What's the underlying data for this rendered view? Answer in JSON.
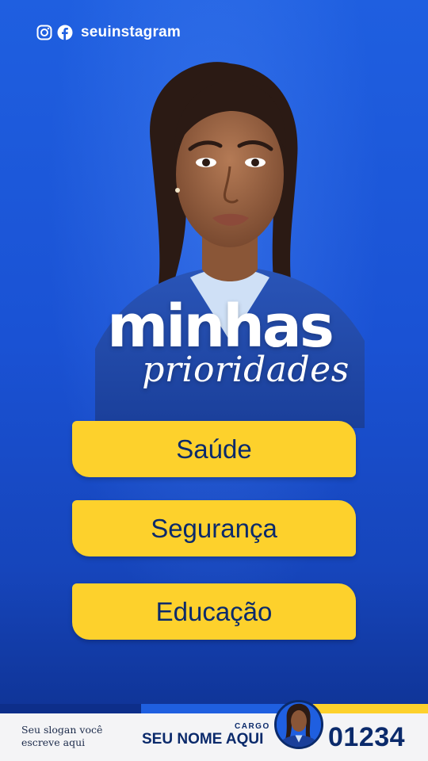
{
  "social": {
    "icons": [
      "instagram-icon",
      "facebook-icon"
    ],
    "handle": "seuinstagram"
  },
  "headline": {
    "title": "minhas",
    "subtitle": "prioridades"
  },
  "priorities": [
    {
      "label": "Saúde"
    },
    {
      "label": "Segurança"
    },
    {
      "label": "Educação"
    }
  ],
  "footer": {
    "slogan": "Seu slogan você escreve aqui",
    "cargo": "CARGO",
    "name": "SEU NOME AQUI",
    "number": "01234"
  },
  "colors": {
    "background": "#1f5fe0",
    "button": "#fdd12c",
    "button_text": "#0b2a6b",
    "footer": "#f4f4f6",
    "accent_navy": "#0d2e8a"
  }
}
